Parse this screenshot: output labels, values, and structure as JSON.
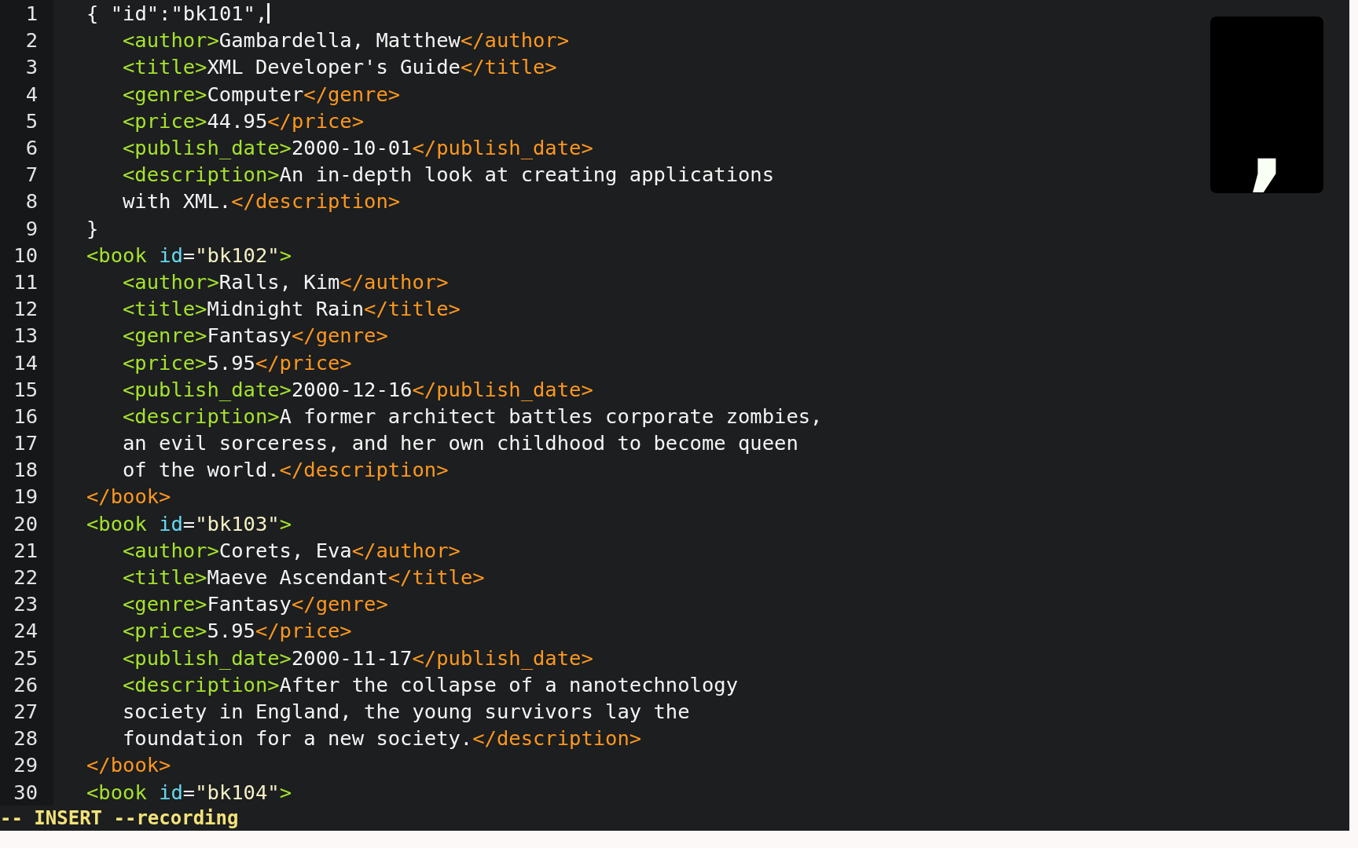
{
  "lines": [
    {
      "number": "1",
      "kind": "top",
      "cursor": true,
      "segments": [
        {
          "kind": "text",
          "text": "{ \"id\":\"bk101\","
        }
      ]
    },
    {
      "number": "2",
      "kind": "child",
      "cursor": false,
      "segments": [
        {
          "kind": "tag",
          "text": "<author>"
        },
        {
          "kind": "text",
          "text": "Gambardella, Matthew"
        },
        {
          "kind": "close",
          "text": "</author>"
        }
      ]
    },
    {
      "number": "3",
      "kind": "child",
      "cursor": false,
      "segments": [
        {
          "kind": "tag",
          "text": "<title>"
        },
        {
          "kind": "text",
          "text": "XML Developer's Guide"
        },
        {
          "kind": "close",
          "text": "</title>"
        }
      ]
    },
    {
      "number": "4",
      "kind": "child",
      "cursor": false,
      "segments": [
        {
          "kind": "tag",
          "text": "<genre>"
        },
        {
          "kind": "text",
          "text": "Computer"
        },
        {
          "kind": "close",
          "text": "</genre>"
        }
      ]
    },
    {
      "number": "5",
      "kind": "child",
      "cursor": false,
      "segments": [
        {
          "kind": "tag",
          "text": "<price>"
        },
        {
          "kind": "text",
          "text": "44.95"
        },
        {
          "kind": "close",
          "text": "</price>"
        }
      ]
    },
    {
      "number": "6",
      "kind": "child",
      "cursor": false,
      "segments": [
        {
          "kind": "tag",
          "text": "<publish_date>"
        },
        {
          "kind": "text",
          "text": "2000-10-01"
        },
        {
          "kind": "close",
          "text": "</publish_date>"
        }
      ]
    },
    {
      "number": "7",
      "kind": "child",
      "cursor": false,
      "segments": [
        {
          "kind": "tag",
          "text": "<description>"
        },
        {
          "kind": "text",
          "text": "An in-depth look at creating applications"
        }
      ]
    },
    {
      "number": "8",
      "kind": "child",
      "cursor": false,
      "segments": [
        {
          "kind": "text",
          "text": "with XML."
        },
        {
          "kind": "close",
          "text": "</description>"
        }
      ]
    },
    {
      "number": "9",
      "kind": "top",
      "cursor": false,
      "segments": [
        {
          "kind": "text",
          "text": "}"
        }
      ]
    },
    {
      "number": "10",
      "kind": "top",
      "cursor": false,
      "segments": [
        {
          "kind": "tag",
          "text": "<book "
        },
        {
          "kind": "attr",
          "text": "id"
        },
        {
          "kind": "text",
          "text": "="
        },
        {
          "kind": "string",
          "text": "\"bk102\""
        },
        {
          "kind": "tag",
          "text": ">"
        }
      ]
    },
    {
      "number": "11",
      "kind": "child",
      "cursor": false,
      "segments": [
        {
          "kind": "tag",
          "text": "<author>"
        },
        {
          "kind": "text",
          "text": "Ralls, Kim"
        },
        {
          "kind": "close",
          "text": "</author>"
        }
      ]
    },
    {
      "number": "12",
      "kind": "child",
      "cursor": false,
      "segments": [
        {
          "kind": "tag",
          "text": "<title>"
        },
        {
          "kind": "text",
          "text": "Midnight Rain"
        },
        {
          "kind": "close",
          "text": "</title>"
        }
      ]
    },
    {
      "number": "13",
      "kind": "child",
      "cursor": false,
      "segments": [
        {
          "kind": "tag",
          "text": "<genre>"
        },
        {
          "kind": "text",
          "text": "Fantasy"
        },
        {
          "kind": "close",
          "text": "</genre>"
        }
      ]
    },
    {
      "number": "14",
      "kind": "child",
      "cursor": false,
      "segments": [
        {
          "kind": "tag",
          "text": "<price>"
        },
        {
          "kind": "text",
          "text": "5.95"
        },
        {
          "kind": "close",
          "text": "</price>"
        }
      ]
    },
    {
      "number": "15",
      "kind": "child",
      "cursor": false,
      "segments": [
        {
          "kind": "tag",
          "text": "<publish_date>"
        },
        {
          "kind": "text",
          "text": "2000-12-16"
        },
        {
          "kind": "close",
          "text": "</publish_date>"
        }
      ]
    },
    {
      "number": "16",
      "kind": "child",
      "cursor": false,
      "segments": [
        {
          "kind": "tag",
          "text": "<description>"
        },
        {
          "kind": "text",
          "text": "A former architect battles corporate zombies,"
        }
      ]
    },
    {
      "number": "17",
      "kind": "child",
      "cursor": false,
      "segments": [
        {
          "kind": "text",
          "text": "an evil sorceress, and her own childhood to become queen"
        }
      ]
    },
    {
      "number": "18",
      "kind": "child",
      "cursor": false,
      "segments": [
        {
          "kind": "text",
          "text": "of the world."
        },
        {
          "kind": "close",
          "text": "</description>"
        }
      ]
    },
    {
      "number": "19",
      "kind": "top",
      "cursor": false,
      "segments": [
        {
          "kind": "close",
          "text": "</book>"
        }
      ]
    },
    {
      "number": "20",
      "kind": "top",
      "cursor": false,
      "segments": [
        {
          "kind": "tag",
          "text": "<book "
        },
        {
          "kind": "attr",
          "text": "id"
        },
        {
          "kind": "text",
          "text": "="
        },
        {
          "kind": "string",
          "text": "\"bk103\""
        },
        {
          "kind": "tag",
          "text": ">"
        }
      ]
    },
    {
      "number": "21",
      "kind": "child",
      "cursor": false,
      "segments": [
        {
          "kind": "tag",
          "text": "<author>"
        },
        {
          "kind": "text",
          "text": "Corets, Eva"
        },
        {
          "kind": "close",
          "text": "</author>"
        }
      ]
    },
    {
      "number": "22",
      "kind": "child",
      "cursor": false,
      "segments": [
        {
          "kind": "tag",
          "text": "<title>"
        },
        {
          "kind": "text",
          "text": "Maeve Ascendant"
        },
        {
          "kind": "close",
          "text": "</title>"
        }
      ]
    },
    {
      "number": "23",
      "kind": "child",
      "cursor": false,
      "segments": [
        {
          "kind": "tag",
          "text": "<genre>"
        },
        {
          "kind": "text",
          "text": "Fantasy"
        },
        {
          "kind": "close",
          "text": "</genre>"
        }
      ]
    },
    {
      "number": "24",
      "kind": "child",
      "cursor": false,
      "segments": [
        {
          "kind": "tag",
          "text": "<price>"
        },
        {
          "kind": "text",
          "text": "5.95"
        },
        {
          "kind": "close",
          "text": "</price>"
        }
      ]
    },
    {
      "number": "25",
      "kind": "child",
      "cursor": false,
      "segments": [
        {
          "kind": "tag",
          "text": "<publish_date>"
        },
        {
          "kind": "text",
          "text": "2000-11-17"
        },
        {
          "kind": "close",
          "text": "</publish_date>"
        }
      ]
    },
    {
      "number": "26",
      "kind": "child",
      "cursor": false,
      "segments": [
        {
          "kind": "tag",
          "text": "<description>"
        },
        {
          "kind": "text",
          "text": "After the collapse of a nanotechnology"
        }
      ]
    },
    {
      "number": "27",
      "kind": "child",
      "cursor": false,
      "segments": [
        {
          "kind": "text",
          "text": "society in England, the young survivors lay the"
        }
      ]
    },
    {
      "number": "28",
      "kind": "child",
      "cursor": false,
      "segments": [
        {
          "kind": "text",
          "text": "foundation for a new society."
        },
        {
          "kind": "close",
          "text": "</description>"
        }
      ]
    },
    {
      "number": "29",
      "kind": "top",
      "cursor": false,
      "segments": [
        {
          "kind": "close",
          "text": "</book>"
        }
      ]
    },
    {
      "number": "30",
      "kind": "top",
      "cursor": false,
      "segments": [
        {
          "kind": "tag",
          "text": "<book "
        },
        {
          "kind": "attr",
          "text": "id"
        },
        {
          "kind": "text",
          "text": "="
        },
        {
          "kind": "string",
          "text": "\"bk104\""
        },
        {
          "kind": "tag",
          "text": ">"
        }
      ]
    }
  ],
  "status_line": "-- INSERT --recording",
  "key_overlay": {
    "key": ","
  }
}
